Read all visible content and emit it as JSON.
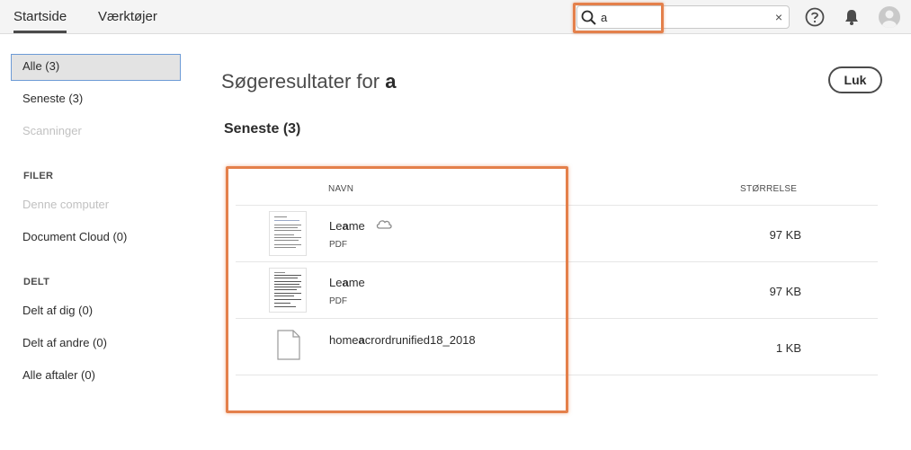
{
  "topbar": {
    "tabs": [
      {
        "label": "Startside",
        "active": true
      },
      {
        "label": "Værktøjer",
        "active": false
      }
    ],
    "search": {
      "value": "a",
      "clear_glyph": "×",
      "icon": "search-icon"
    },
    "icons": [
      "help-icon",
      "bell-icon",
      "avatar-icon"
    ]
  },
  "sidebar": {
    "items": [
      {
        "label": "Alle (3)",
        "active": true
      },
      {
        "label": "Seneste (3)"
      },
      {
        "label": "Scanninger",
        "disabled": true
      }
    ],
    "files_heading": "FILER",
    "files_items": [
      {
        "label": "Denne computer",
        "disabled": true
      },
      {
        "label": "Document Cloud (0)"
      }
    ],
    "shared_heading": "DELT",
    "shared_items": [
      {
        "label": "Delt af dig (0)"
      },
      {
        "label": "Delt af andre (0)"
      },
      {
        "label": "Alle aftaler (0)"
      }
    ]
  },
  "main": {
    "title_prefix": "Søgeresultater for",
    "title_query": "a",
    "close_label": "Luk",
    "section_heading": "Seneste (3)",
    "columns": {
      "name": "NAVN",
      "size": "STØRRELSE"
    },
    "files": [
      {
        "name_pre": "Le",
        "name_match": "a",
        "name_post": "me",
        "type": "PDF",
        "size": "97 KB",
        "cloud": true
      },
      {
        "name_pre": "Le",
        "name_match": "a",
        "name_post": "me",
        "type": "PDF",
        "size": "97 KB",
        "cloud": false
      },
      {
        "name_pre": "home",
        "name_match": "a",
        "name_post": "crordrunified18_2018",
        "type": "",
        "size": "1 KB",
        "cloud": false
      }
    ]
  },
  "colors": {
    "highlight": "#e4804b",
    "active_border": "#6d9bd6",
    "topbar_bg": "#f4f4f4"
  }
}
